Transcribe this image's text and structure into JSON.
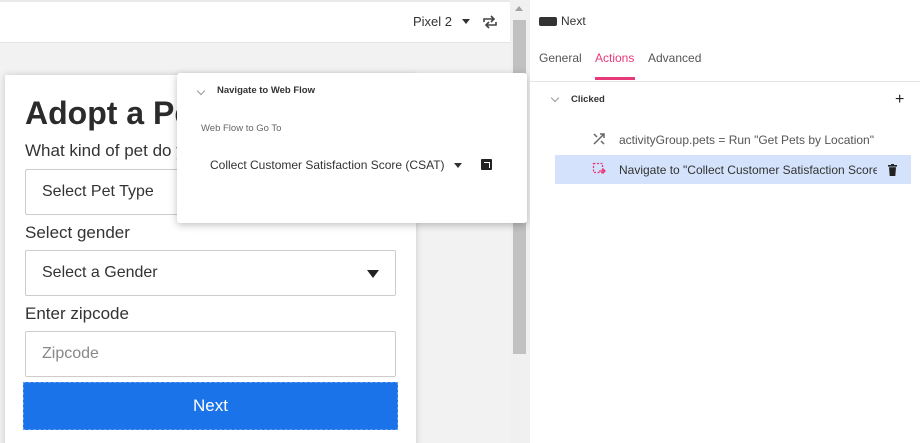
{
  "toolbar": {
    "device": "Pixel 2",
    "device_icon": "chevron-down-icon",
    "rotate_icon": "rotate-icon"
  },
  "form": {
    "title": "Adopt a Pet",
    "pet_question": "What kind of pet do you want?",
    "pet_type_placeholder": "Select Pet Type",
    "gender_label": "Select gender",
    "gender_placeholder": "Select a Gender",
    "zip_label": "Enter zipcode",
    "zip_placeholder": "Zipcode",
    "next_button": "Next",
    "button_color": "#1a73e8"
  },
  "popover": {
    "title": "Navigate to Web Flow",
    "subtitle": "Web Flow to Go To",
    "selected_flow": "Collect Customer Satisfaction Score (CSAT)"
  },
  "panel": {
    "component": "Next",
    "tabs": [
      {
        "label": "General",
        "active": false
      },
      {
        "label": "Actions",
        "active": true
      },
      {
        "label": "Advanced",
        "active": false
      }
    ],
    "event": "Clicked",
    "accent": "#e6397a",
    "actions": [
      {
        "text": "activityGroup.pets = Run \"Get Pets by Location\"",
        "icon": "transform-icon",
        "selected": false
      },
      {
        "text": "Navigate to \"Collect Customer Satisfaction Score (CSAT)\"",
        "icon": "navigate-icon",
        "selected": true
      }
    ]
  }
}
